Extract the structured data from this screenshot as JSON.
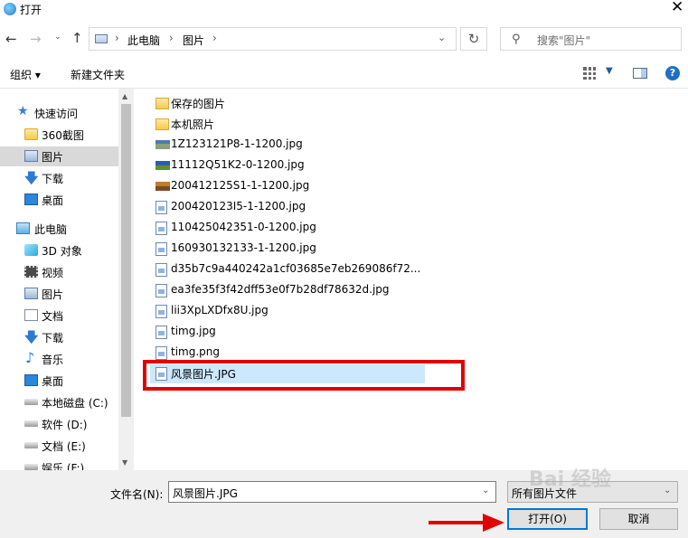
{
  "window": {
    "title": "打开"
  },
  "address": {
    "segments": [
      "此电脑",
      "图片"
    ],
    "separator": "›"
  },
  "search": {
    "placeholder": "搜索\"图片\""
  },
  "toolbar": {
    "organize": "组织 ▾",
    "new_folder": "新建文件夹"
  },
  "sidebar": {
    "items": [
      {
        "label": "快速访问",
        "icon": "star-icon"
      },
      {
        "label": "360截图",
        "icon": "folder-icon"
      },
      {
        "label": "图片",
        "icon": "pictures-icon",
        "selected": true
      },
      {
        "label": "下载",
        "icon": "download-icon"
      },
      {
        "label": "桌面",
        "icon": "desktop-icon"
      },
      {
        "label": "此电脑",
        "icon": "computer-icon"
      },
      {
        "label": "3D 对象",
        "icon": "3d-objects-icon"
      },
      {
        "label": "视频",
        "icon": "video-icon"
      },
      {
        "label": "图片",
        "icon": "pictures-icon"
      },
      {
        "label": "文档",
        "icon": "document-icon"
      },
      {
        "label": "下载",
        "icon": "download-icon"
      },
      {
        "label": "音乐",
        "icon": "music-icon"
      },
      {
        "label": "桌面",
        "icon": "desktop-icon"
      },
      {
        "label": "本地磁盘 (C:)",
        "icon": "drive-icon"
      },
      {
        "label": "软件 (D:)",
        "icon": "drive-icon"
      },
      {
        "label": "文档 (E:)",
        "icon": "drive-icon"
      },
      {
        "label": "娱乐 (F:)",
        "icon": "drive-icon"
      }
    ]
  },
  "files": [
    {
      "name": "保存的图片",
      "type": "folder"
    },
    {
      "name": "本机照片",
      "type": "folder"
    },
    {
      "name": "1Z123121P8-1-1200.jpg",
      "type": "image"
    },
    {
      "name": "11112Q51K2-0-1200.jpg",
      "type": "image"
    },
    {
      "name": "200412125S1-1-1200.jpg",
      "type": "image"
    },
    {
      "name": "200420123I5-1-1200.jpg",
      "type": "image"
    },
    {
      "name": "110425042351-0-1200.jpg",
      "type": "image"
    },
    {
      "name": "160930132133-1-1200.jpg",
      "type": "image"
    },
    {
      "name": "d35b7c9a440242a1cf03685e7eb269086f72...",
      "type": "image"
    },
    {
      "name": "ea3fe35f3f42dff53e0f7b28df78632d.jpg",
      "type": "image"
    },
    {
      "name": "lii3XpLXDfx8U.jpg",
      "type": "image"
    },
    {
      "name": "timg.jpg",
      "type": "image"
    },
    {
      "name": "timg.png",
      "type": "image"
    },
    {
      "name": "风景图片.JPG",
      "type": "image",
      "selected": true
    }
  ],
  "bottom": {
    "filename_label": "文件名(N):",
    "filename_value": "风景图片.JPG",
    "filter_value": "所有图片文件",
    "open_button": "打开(O)",
    "cancel_button": "取消"
  },
  "colors": {
    "selection": "#cce8ff",
    "highlight": "#e00000",
    "accent": "#0078d7"
  },
  "watermark": "Bai 经验"
}
